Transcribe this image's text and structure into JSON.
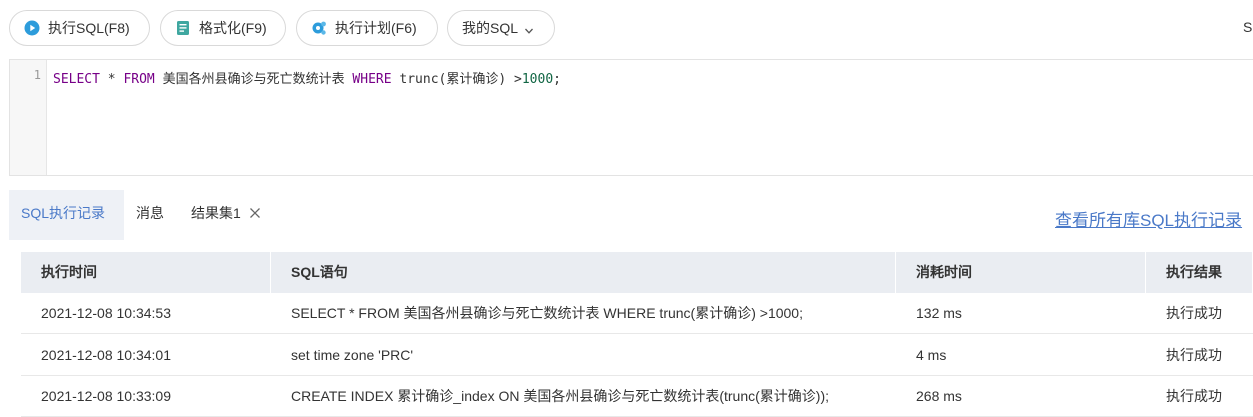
{
  "toolbar": {
    "exec_label": "执行SQL(F8)",
    "format_label": "格式化(F9)",
    "plan_label": "执行计划(F6)",
    "mysql_label": "我的SQL",
    "right_partial": "S"
  },
  "editor": {
    "line_number": "1",
    "tokens": {
      "select": "SELECT",
      "star": " * ",
      "from": "FROM",
      "table": " 美国各州县确诊与死亡数统计表 ",
      "where": "WHERE",
      "func": " trunc(累计确诊) >",
      "number": "1000",
      "end": ";"
    }
  },
  "tabs": {
    "history": "SQL执行记录",
    "messages": "消息",
    "result": "结果集1"
  },
  "view_all_link": "查看所有库SQL执行记录",
  "table": {
    "headers": [
      "执行时间",
      "SQL语句",
      "消耗时间",
      "执行结果"
    ],
    "rows": [
      {
        "time": "2021-12-08 10:34:53",
        "sql": "SELECT * FROM 美国各州县确诊与死亡数统计表 WHERE trunc(累计确诊) >1000;",
        "cost": "132 ms",
        "result": "执行成功"
      },
      {
        "time": "2021-12-08 10:34:01",
        "sql": "set time zone 'PRC'",
        "cost": "4 ms",
        "result": "执行成功"
      },
      {
        "time": "2021-12-08 10:33:09",
        "sql": "CREATE INDEX 累计确诊_index ON 美国各州县确诊与死亡数统计表(trunc(累计确诊));",
        "cost": "268 ms",
        "result": "执行成功"
      }
    ]
  },
  "colors": {
    "accent": "#4a79c8",
    "exec_icon": "#2d9cdb",
    "format_icon": "#3fa7a0",
    "plan_icon": "#2d9cdb",
    "keyword": "#770088",
    "number": "#116644"
  }
}
